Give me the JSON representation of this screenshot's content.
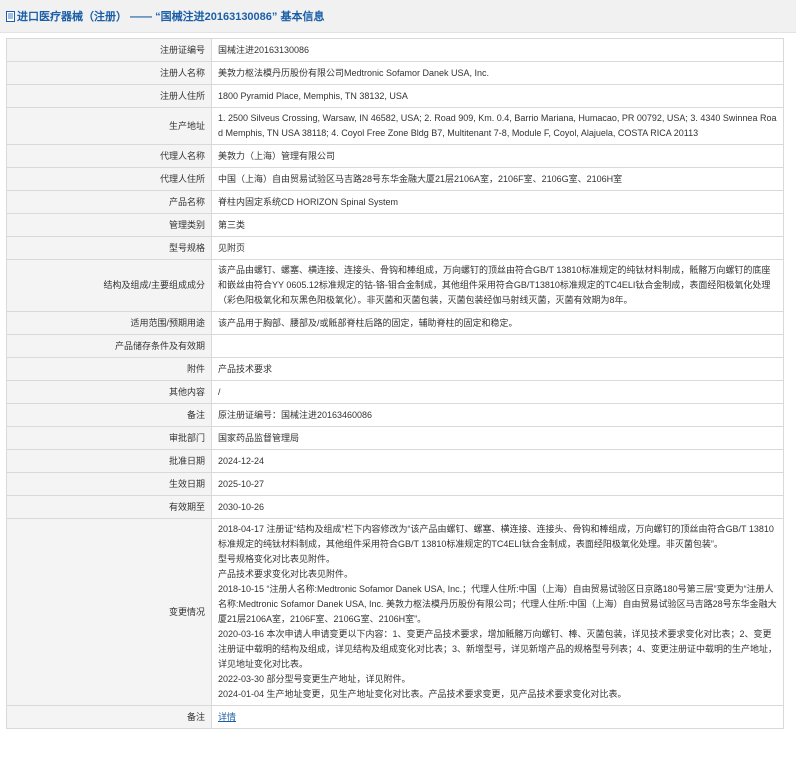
{
  "header": {
    "title": "进口医疗器械（注册） —— “国械注进20163130086” 基本信息"
  },
  "rows": [
    {
      "label": "注册证编号",
      "value": "国械注进20163130086"
    },
    {
      "label": "注册人名称",
      "value": "美敦力枢法模丹历股份有限公司Medtronic Sofamor Danek USA, Inc."
    },
    {
      "label": "注册人住所",
      "value": "1800 Pyramid Place, Memphis, TN 38132, USA"
    },
    {
      "label": "生产地址",
      "value": "1. 2500 Silveus Crossing, Warsaw, IN 46582, USA; 2. Road 909, Km. 0.4, Barrio Mariana, Humacao, PR 00792, USA; 3. 4340 Swinnea Road Memphis, TN USA 38118; 4. Coyol Free Zone Bldg B7, Multitenant 7-8, Module F, Coyol, Alajuela, COSTA RICA 20113"
    },
    {
      "label": "代理人名称",
      "value": "美敦力（上海）管理有限公司"
    },
    {
      "label": "代理人住所",
      "value": "中国（上海）自由贸易试验区马吉路28号东华金融大厦21层2106A室，2106F室、2106G室、2106H室"
    },
    {
      "label": "产品名称",
      "value": "脊柱内固定系统CD HORIZON Spinal System"
    },
    {
      "label": "管理类别",
      "value": "第三类"
    },
    {
      "label": "型号规格",
      "value": "见附页"
    },
    {
      "label": "结构及组成/主要组成成分",
      "value": "该产品由螺钉、螺塞、横连接、连接头、骨钩和棒组成，万向螺钉的顶丝由符合GB/T 13810标准规定的纯钛材料制成，骶髂万向螺钉的底座和嵌丝由符合YY 0605.12标准规定的钴-铬-钼合金制成，其他组件采用符合GB/T13810标准规定的TC4ELI钛合金制成，表面经阳极氧化处理（彩色阳极氧化和灰黑色阳极氧化）。非灭菌和灭菌包装，灭菌包装经伽马射线灭菌，灭菌有效期为8年。"
    },
    {
      "label": "适用范围/预期用途",
      "value": "该产品用于胸部、腰部及/或骶部脊柱后路的固定，辅助脊柱的固定和稳定。"
    },
    {
      "label": "产品储存条件及有效期",
      "value": ""
    },
    {
      "label": "附件",
      "value": "产品技术要求"
    },
    {
      "label": "其他内容",
      "value": "/"
    },
    {
      "label": "备注",
      "value": "原注册证编号：国械注进20163460086"
    },
    {
      "label": "审批部门",
      "value": "国家药品监督管理局"
    },
    {
      "label": "批准日期",
      "value": "2024-12-24"
    },
    {
      "label": "生效日期",
      "value": "2025-10-27"
    },
    {
      "label": "有效期至",
      "value": "2030-10-26"
    }
  ],
  "changes": {
    "label": "变更情况",
    "lines": [
      "2018-04-17 注册证“结构及组成”栏下内容修改为“该产品由螺钉、螺塞、横连接、连接头、骨钩和棒组成，万向螺钉的顶丝由符合GB/T 13810标准规定的纯钛材料制成，其他组件采用符合GB/T 13810标准规定的TC4ELI钛合金制成，表面经阳极氧化处理。非灭菌包装”。",
      "型号规格变化对比表见附件。",
      "产品技术要求变化对比表见附件。",
      "2018-10-15 “注册人名称:Medtronic Sofamor Danek USA, Inc.；代理人住所:中国（上海）自由贸易试验区日京路180号第三层”变更为“注册人名称:Medtronic Sofamor Danek USA, Inc. 美敦力枢法模丹历股份有限公司；代理人住所:中国（上海）自由贸易试验区马吉路28号东华金融大厦21层2106A室，2106F室、2106G室、2106H室”。",
      "2020-03-16 本次申请人申请变更以下内容：1、变更产品技术要求，增加骶髂万向螺钉、棒、灭菌包装，详见技术要求变化对比表；2、变更注册证中载明的结构及组成，详见结构及组成变化对比表；3、新增型号，详见新增产品的规格型号列表；4、变更注册证中载明的生产地址，详见地址变化对比表。",
      "2022-03-30 部分型号变更生产地址，详见附件。",
      "2024-01-04 生产地址变更，见生产地址变化对比表。产品技术要求变更，见产品技术要求变化对比表。"
    ]
  },
  "last_row": {
    "label": "备注",
    "link": "详情"
  },
  "colors": {
    "title": "#1a5fa8",
    "label_bg": "#f4f4f4",
    "border": "#d9d9d9"
  }
}
